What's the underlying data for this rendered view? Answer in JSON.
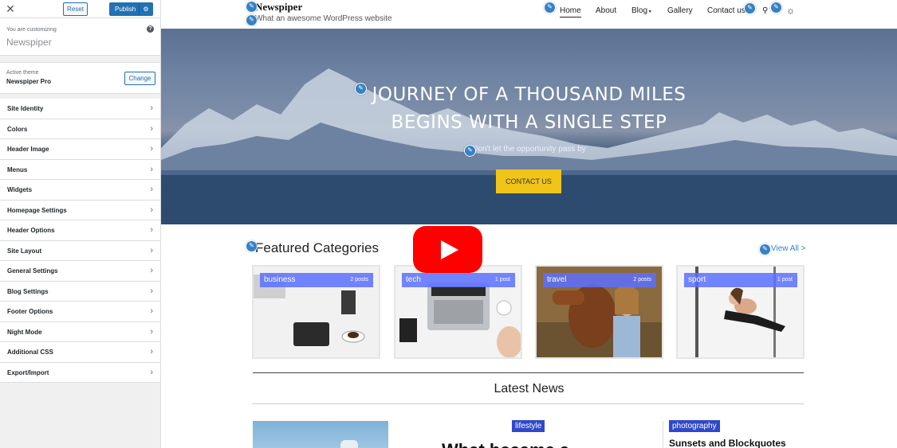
{
  "customizer": {
    "close_icon": "close-icon",
    "reset_label": "Reset",
    "publish_label": "Publish",
    "customizing_label": "You are customizing",
    "site_name": "Newspiper",
    "active_theme_label": "Active theme",
    "theme_name": "Newspiper Pro",
    "change_label": "Change",
    "menu": [
      {
        "label": "Site Identity"
      },
      {
        "label": "Colors"
      },
      {
        "label": "Header Image"
      },
      {
        "label": "Menus"
      },
      {
        "label": "Widgets"
      },
      {
        "label": "Homepage Settings"
      },
      {
        "label": "Header Options"
      },
      {
        "label": "Site Layout"
      },
      {
        "label": "General Settings"
      },
      {
        "label": "Blog Settings"
      },
      {
        "label": "Footer Options"
      },
      {
        "label": "Night Mode"
      },
      {
        "label": "Additional CSS"
      },
      {
        "label": "Export/Import"
      }
    ]
  },
  "site": {
    "title": "Newspiper",
    "tagline": "What an awesome WordPress website",
    "nav": {
      "home": "Home",
      "about": "About",
      "blog": "Blog",
      "gallery": "Gallery",
      "contact": "Contact us"
    }
  },
  "hero": {
    "line1": "JOURNEY OF A THOUSAND MILES",
    "line2": "BEGINS WITH A SINGLE STEP",
    "subtitle": "Don't let the opportunity pass by",
    "cta": "CONTACT US"
  },
  "featured": {
    "heading": "Featured Categories",
    "view_all": "View All >",
    "categories": [
      {
        "name": "business",
        "count": "2 posts"
      },
      {
        "name": "tech",
        "count": "1 post"
      },
      {
        "name": "travel",
        "count": "2 posts"
      },
      {
        "name": "sport",
        "count": "1 post"
      }
    ]
  },
  "latest": {
    "heading": "Latest News",
    "tag_lifestyle": "lifestyle",
    "tag_photography": "photography",
    "title_main": "What became a",
    "title_side": "Sunsets and Blockquotes"
  },
  "colors": {
    "wp_blue": "#2271b1",
    "cta_yellow": "#f0c419",
    "category_bar": "#5b6eff",
    "tag_blue": "#2f48c9",
    "youtube_red": "#ff0000"
  }
}
